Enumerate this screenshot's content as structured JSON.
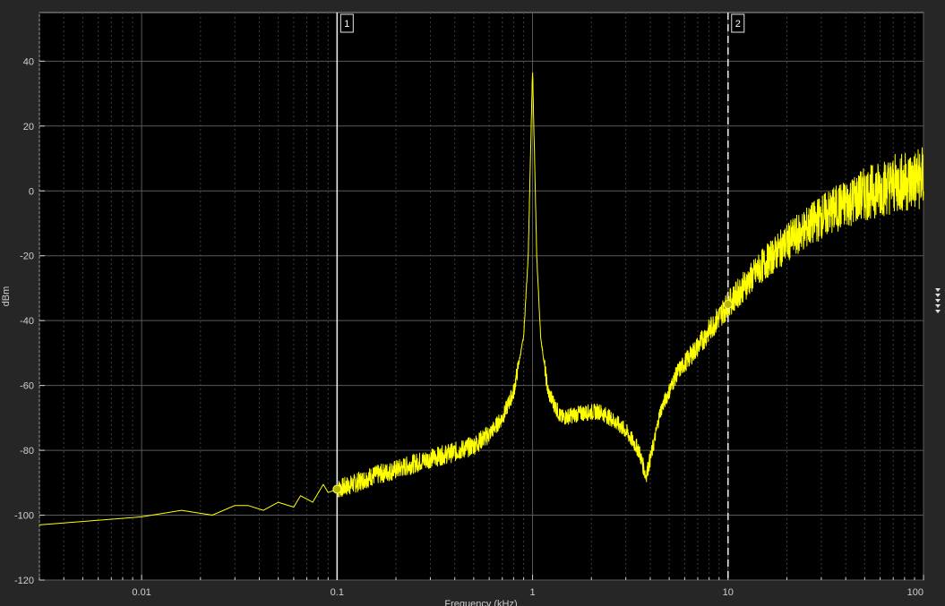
{
  "chart_data": {
    "type": "line",
    "title": "",
    "xlabel": "Frequency (kHz)",
    "ylabel": "dBm",
    "xscale": "log",
    "xlim": [
      0.003,
      100
    ],
    "ylim": [
      -120,
      55
    ],
    "xticks": [
      0.01,
      0.1,
      1,
      10,
      100
    ],
    "xtick_labels": [
      "0.01",
      "0.1",
      "1",
      "10",
      "100"
    ],
    "yticks": [
      -120,
      -100,
      -80,
      -60,
      -40,
      -20,
      0,
      20,
      40
    ],
    "ytick_labels": [
      "-120",
      "-100",
      "-80",
      "-60",
      "-40",
      "-20",
      "0",
      "20",
      "40"
    ],
    "grid": true,
    "background": "#000000",
    "trace_color": "#ffff00",
    "series": [
      {
        "x": [
          0.003,
          0.01,
          0.016,
          0.023,
          0.03,
          0.035,
          0.042,
          0.05,
          0.06,
          0.065,
          0.075,
          0.085,
          0.09,
          0.1,
          0.12,
          0.15,
          0.2,
          0.25,
          0.3,
          0.4,
          0.5,
          0.6,
          0.7,
          0.8,
          0.9,
          0.95,
          1.0,
          1.05,
          1.1,
          1.2,
          1.4,
          1.8,
          2.2,
          2.5,
          3.0,
          3.5,
          3.8,
          4.1,
          4.5,
          5.5,
          7,
          10,
          15,
          20,
          30,
          50,
          70,
          100
        ],
        "y": [
          -103,
          -100.5,
          -98.5,
          -100,
          -97,
          -97,
          -98.5,
          -96,
          -97.5,
          -94,
          -96,
          -90.5,
          -93,
          -92,
          -90.5,
          -88,
          -86,
          -84,
          -82.5,
          -80.5,
          -78.5,
          -75,
          -70,
          -62,
          -45,
          -20,
          38,
          -20,
          -45,
          -62,
          -70,
          -68.5,
          -68,
          -70,
          -74,
          -80,
          -88,
          -80,
          -68,
          -56,
          -48,
          -35,
          -23,
          -16,
          -8,
          -1,
          2,
          4
        ]
      }
    ],
    "cursors": [
      {
        "label": "1",
        "x": 0.1,
        "y": -92,
        "style": "solid"
      },
      {
        "label": "2",
        "x": 10,
        "y": -35,
        "style": "dashed"
      }
    ]
  }
}
